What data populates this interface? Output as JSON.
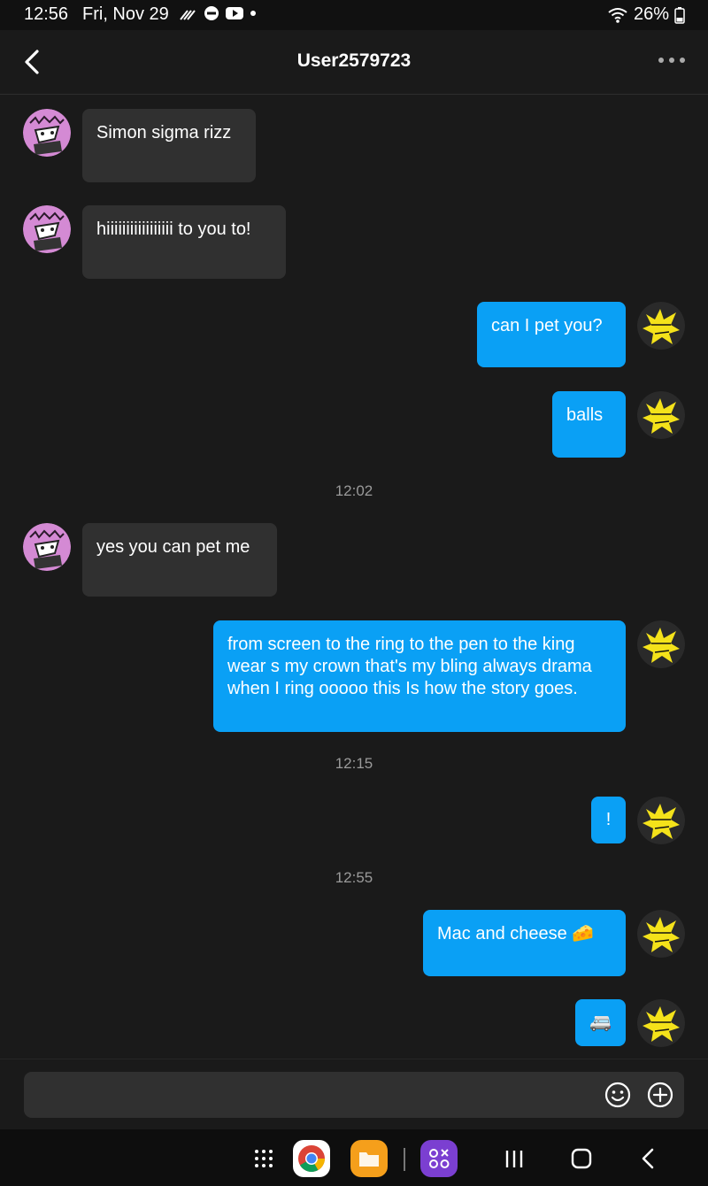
{
  "status_bar": {
    "time": "12:56",
    "date": "Fri, Nov 29",
    "battery": "26%"
  },
  "header": {
    "title": "User2579723",
    "back_icon": "chevron-left-icon",
    "more_icon": "more-dots-icon"
  },
  "messages": [
    {
      "side": "in",
      "text": "Simon sigma rizz"
    },
    {
      "side": "in",
      "text": "hiiiiiiiiiiiiiiiii to you to!"
    },
    {
      "side": "out",
      "text": "can I pet you?"
    },
    {
      "side": "out",
      "text": "balls"
    },
    {
      "timestamp": "12:02"
    },
    {
      "side": "in",
      "text": "yes you can pet me"
    },
    {
      "side": "out",
      "text": "from screen to the ring to the pen to the king wear s my crown that's my bling always drama when I ring ooooo this Is how the story goes."
    },
    {
      "timestamp": "12:15"
    },
    {
      "side": "out",
      "text": "!"
    },
    {
      "timestamp": "12:55"
    },
    {
      "side": "out",
      "text": "Mac and  cheese 🧀"
    },
    {
      "side": "out",
      "text": "🚐"
    }
  ],
  "composer": {
    "placeholder": "",
    "emoji_icon": "emoji-icon",
    "add_icon": "add-circle-icon"
  },
  "colors": {
    "background": "#1a1a1a",
    "incoming_bubble": "#303030",
    "outgoing_bubble": "#0aa0f5",
    "timestamp": "#9a9a9a"
  }
}
